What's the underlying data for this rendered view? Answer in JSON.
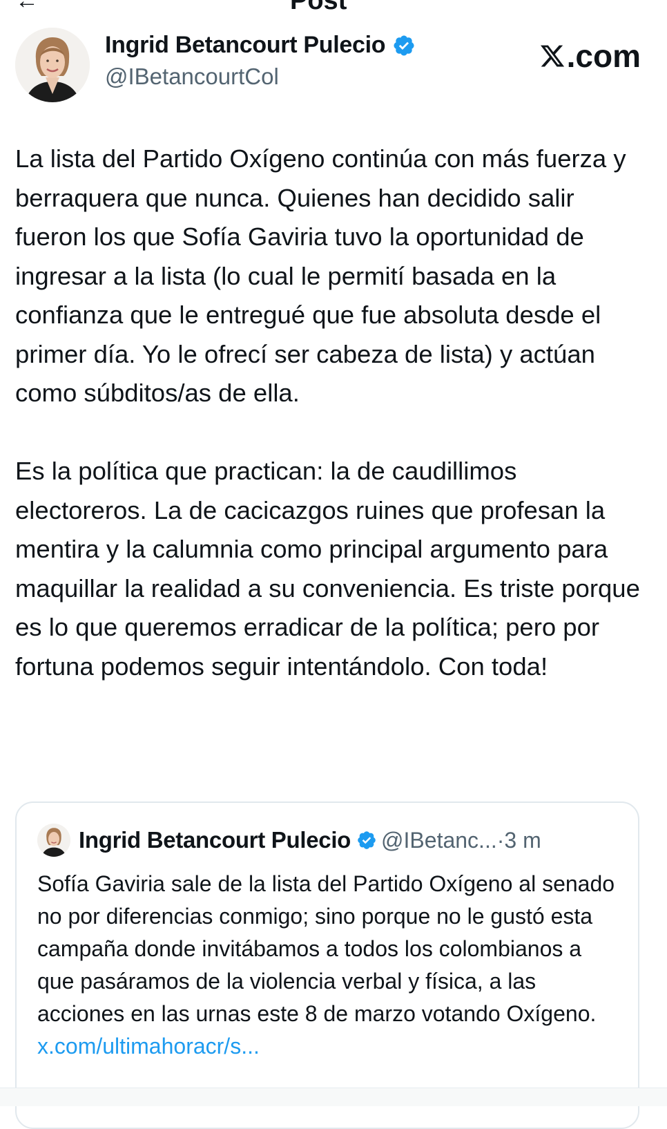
{
  "topbar": {
    "back_glyph": "←",
    "title": "Post"
  },
  "author": {
    "name": "Ingrid Betancourt Pulecio",
    "handle": "@IBetancourtCol",
    "verified_color": "#1d9bf0",
    "avatar_icon": "avatar-photo"
  },
  "watermark": {
    "text": ".com"
  },
  "post": {
    "paragraph_1": "La lista del Partido Oxígeno continúa con más fuerza y berraquera que nunca. Quienes han decidido salir fueron los que Sofía Gaviria tuvo la oportunidad de ingresar a la lista (lo cual le permití basada en la confianza que le entregué que fue absoluta desde el primer día. Yo le ofrecí ser cabeza de lista) y actúan como súbditos/as de ella.",
    "paragraph_2": "Es la política que practican: la de caudillimos electoreros. La de cacicazgos ruines que profesan la mentira y la calumnia como principal argumento para maquillar la realidad a su conveniencia. Es triste porque es lo que queremos erradicar de la política; pero por fortuna podemos seguir intentándolo. Con toda!"
  },
  "quoted": {
    "name": "Ingrid Betancourt Pulecio",
    "handle": "@IBetanc...",
    "separator": "·",
    "time": "3 m",
    "text": "Sofía Gaviria sale de la lista del Partido Oxígeno al senado no por diferencias conmigo; sino porque no le gustó esta campaña donde invitábamos a todos los colombianos a que pasáramos de la violencia verbal y física, a las acciones en las urnas este 8 de marzo votando Oxígeno.",
    "link": "x.com/ultimahoracr/s..."
  },
  "colors": {
    "text": "#0f1419",
    "secondary": "#536471",
    "link": "#1d9bf0",
    "border": "#e1e8ed"
  }
}
